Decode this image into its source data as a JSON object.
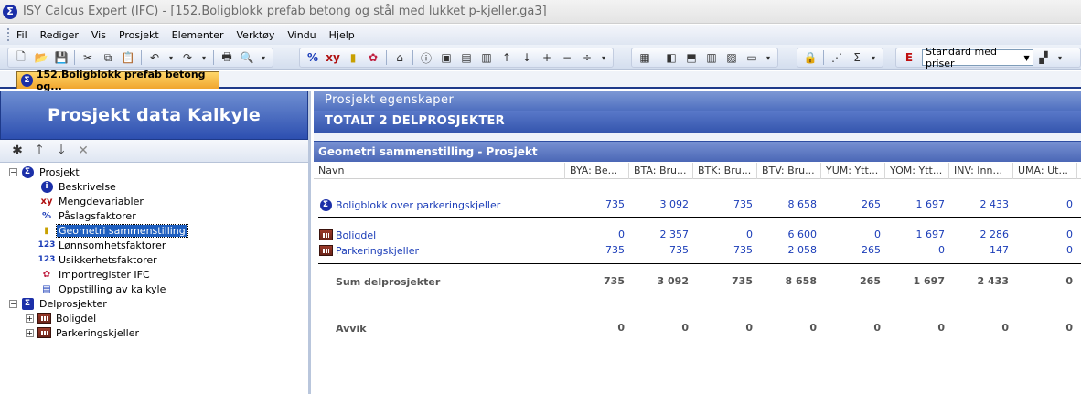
{
  "window": {
    "title": "ISY Calcus Expert (IFC) - [152.Boligblokk prefab betong og stål med lukket p-kjeller.ga3]"
  },
  "menu": [
    "Fil",
    "Rediger",
    "Vis",
    "Prosjekt",
    "Elementer",
    "Verktøy",
    "Vindu",
    "Hjelp"
  ],
  "toolbar": {
    "price_mode": "Standard med priser"
  },
  "document_tab": {
    "label": "152.Boligblokk prefab betong og..."
  },
  "left_panel": {
    "header": "Prosjekt data Kalkyle",
    "tree": [
      {
        "label": "Prosjekt",
        "icon": "sigma-icon",
        "level": 0,
        "expander": "−"
      },
      {
        "label": "Beskrivelse",
        "icon": "info-icon",
        "level": 1
      },
      {
        "label": "Mengdevariabler",
        "icon": "xy-icon",
        "level": 1
      },
      {
        "label": "Påslagsfaktorer",
        "icon": "percent-icon",
        "level": 1
      },
      {
        "label": "Geometri sammenstilling",
        "icon": "ruler-icon",
        "level": 1,
        "selected": true
      },
      {
        "label": "Lønnsomhetsfaktorer",
        "icon": "123-icon",
        "level": 1
      },
      {
        "label": "Usikkerhetsfaktorer",
        "icon": "123-icon",
        "level": 1
      },
      {
        "label": "Importregister IFC",
        "icon": "ifc-icon",
        "level": 1
      },
      {
        "label": "Oppstilling av kalkyle",
        "icon": "table-icon",
        "level": 1
      },
      {
        "label": "Delprosjekter",
        "icon": "sigma-folder-icon",
        "level": 0,
        "expander": "−"
      },
      {
        "label": "Boligdel",
        "icon": "building-icon",
        "level": 1,
        "expander": "+"
      },
      {
        "label": "Parkeringskjeller",
        "icon": "building-icon",
        "level": 1,
        "expander": "+"
      }
    ]
  },
  "right_panel": {
    "heading1": "Prosjekt egenskaper",
    "heading2": "TOTALT 2 DELPROSJEKTER",
    "section_title": "Geometri sammenstilling - Prosjekt",
    "columns": [
      "Navn",
      "BYA: Be...",
      "BTA: Bru...",
      "BTK: Bru...",
      "BTV: Bru...",
      "YUM: Ytt...",
      "YOM: Ytt...",
      "INV: Inn...",
      "UMA: Ut..."
    ],
    "rows": {
      "total": {
        "name": "Boligblokk over parkeringskjeller",
        "values": [
          "735",
          "3 092",
          "735",
          "8 658",
          "265",
          "1 697",
          "2 433",
          "0"
        ]
      },
      "boligdel": {
        "name": "Boligdel",
        "values": [
          "0",
          "2 357",
          "0",
          "6 600",
          "0",
          "1 697",
          "2 286",
          "0"
        ]
      },
      "parkering": {
        "name": "Parkeringskjeller",
        "values": [
          "735",
          "735",
          "735",
          "2 058",
          "265",
          "0",
          "147",
          "0"
        ]
      },
      "sum": {
        "name": "Sum delprosjekter",
        "values": [
          "735",
          "3 092",
          "735",
          "8 658",
          "265",
          "1 697",
          "2 433",
          "0"
        ]
      },
      "avvik": {
        "name": "Avvik",
        "values": [
          "0",
          "0",
          "0",
          "0",
          "0",
          "0",
          "0",
          "0"
        ]
      }
    }
  }
}
